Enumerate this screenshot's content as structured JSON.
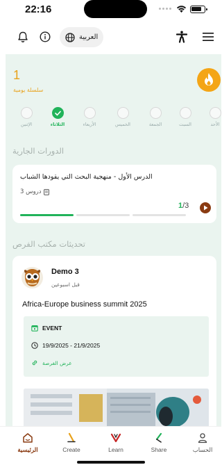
{
  "status_bar": {
    "time": "22:16"
  },
  "toolbar": {
    "language_label": "العربية"
  },
  "streak": {
    "count": "1",
    "label": "سلسلة يومية",
    "days": [
      {
        "label": "الأحد",
        "done": false,
        "active": false
      },
      {
        "label": "السبت",
        "done": false,
        "active": false
      },
      {
        "label": "الجمعة",
        "done": false,
        "active": false
      },
      {
        "label": "الخميس",
        "done": false,
        "active": false
      },
      {
        "label": "الأربعاء",
        "done": false,
        "active": false
      },
      {
        "label": "الثلاثاء",
        "done": true,
        "active": true
      },
      {
        "label": "الإثنين",
        "done": false,
        "active": false
      }
    ]
  },
  "courses": {
    "section_title": "الدورات الجارية",
    "items": [
      {
        "title": "الدرس الأول - منهجية البحث التي يقودها الشباب",
        "lessons": "3 دروس",
        "progress_current": "1",
        "progress_total": "/3",
        "segments_completed": 1,
        "segments_total": 3
      }
    ]
  },
  "opportunities": {
    "section_title": "تحديثات مكتب الفرص",
    "items": [
      {
        "poster_name": "Demo 3",
        "posted_time": "قبل اسبوعين",
        "title": "Africa-Europe business summit 2025",
        "type": "EVENT",
        "dates": "19/9/2025 - 21/9/2025",
        "link_label": "عرض الفرصة"
      }
    ]
  },
  "bottom_nav": {
    "items": [
      {
        "label": "الرئيسية",
        "active": true
      },
      {
        "label": "Create",
        "active": false
      },
      {
        "label": "Learn",
        "active": false
      },
      {
        "label": "Share",
        "active": false
      },
      {
        "label": "الحساب",
        "active": false
      }
    ]
  },
  "colors": {
    "accent_green": "#21b35a",
    "streak_orange": "#e8a11a",
    "brand_brown": "#8a3b12",
    "content_bg": "#eaf4ef"
  }
}
